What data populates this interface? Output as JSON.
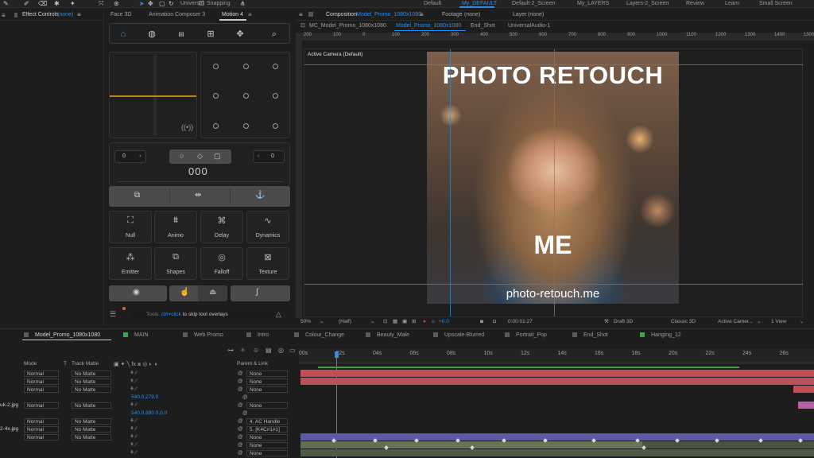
{
  "toolbar": {
    "universal_label": "Universal",
    "snapping_label": "Snapping",
    "workspaces": [
      "Default",
      "My_DEFAULT",
      "Default-2_Screen",
      "My_LAYERS",
      "Layers-2_Screen",
      "Review",
      "Learn",
      "Small Screen"
    ],
    "active_workspace": "My_DEFAULT"
  },
  "effect_controls": {
    "title": "Effect Controls",
    "value": "(none)"
  },
  "motion_panel": {
    "tabs": [
      "Face 3D",
      "Animation Composer 3",
      "Motion 4"
    ],
    "active_tab": "Motion 4",
    "counter_left": "0",
    "counter_right": "0",
    "counter_center": "000",
    "grid_buttons": [
      {
        "label": "Null",
        "icon": "null-icon"
      },
      {
        "label": "Animo",
        "icon": "animo-icon"
      },
      {
        "label": "Delay",
        "icon": "delay-icon"
      },
      {
        "label": "Dynamics",
        "icon": "dynamics-icon"
      },
      {
        "label": "Emitter",
        "icon": "emitter-icon"
      },
      {
        "label": "Shapes",
        "icon": "shapes-icon"
      },
      {
        "label": "Falloff",
        "icon": "falloff-icon"
      },
      {
        "label": "Texture",
        "icon": "texture-icon"
      }
    ],
    "tip_prefix": "Tools:",
    "tip_key": "ctrl+click",
    "tip_suffix": "to skip tool overlays"
  },
  "composition": {
    "header_label": "Composition",
    "header_name": "Model_Promo_1080x1080",
    "footage_label": "Footage",
    "footage_value": "(none)",
    "layer_label": "Layer",
    "layer_value": "(none)",
    "tabs": [
      "MC_Model_Promo_1080x1080",
      "Model_Promo_1080x1080",
      "End_Shot",
      "UniversalAudio-1"
    ],
    "active_tab": "Model_Promo_1080x1080",
    "camera_label": "Active Camera (Default)",
    "ruler_ticks": [
      "200",
      "100",
      "0",
      "100",
      "200",
      "300",
      "400",
      "500",
      "600",
      "700",
      "800",
      "900",
      "1000",
      "1100",
      "1200",
      "1300",
      "1400",
      "1500"
    ],
    "photo_title": "PHOTO RETOUCH",
    "photo_sub": "ME",
    "photo_url": "photo-retouch.me",
    "footer": {
      "zoom": "50%",
      "resolution": "(Half)",
      "exposure": "+0.0",
      "timecode": "0:00:01:27",
      "renderer": "Draft 3D",
      "renderer_mode": "Classic 3D",
      "camera": "Active Camer...",
      "view": "1 View"
    }
  },
  "timeline": {
    "tabs": [
      {
        "label": "Model_Promo_1080x1080",
        "color": "#5b5b5b"
      },
      {
        "label": "MAIN",
        "color": "#3fa34d"
      },
      {
        "label": "Web Promo",
        "color": "#5a5a5a"
      },
      {
        "label": "Intro",
        "color": "#5a5a5a"
      },
      {
        "label": "Colour_Change",
        "color": "#5a5a5a"
      },
      {
        "label": "Beauty_Male",
        "color": "#5a5a5a"
      },
      {
        "label": "Upscale-Blurred",
        "color": "#5a5a5a"
      },
      {
        "label": "Portrait_Pop",
        "color": "#5a5a5a"
      },
      {
        "label": "End_Shot",
        "color": "#5a5a5a"
      },
      {
        "label": "Hanging_12",
        "color": "#3fa34d"
      }
    ],
    "col_mode": "Mode",
    "col_t": "T",
    "col_trackmatte": "Track Matte",
    "col_parent": "Parent & Link",
    "ticks": [
      "00s",
      "02s",
      "04s",
      "06s",
      "08s",
      "10s",
      "12s",
      "14s",
      "16s",
      "18s",
      "20s",
      "22s",
      "24s",
      "26s"
    ],
    "rows": [
      {
        "name": "",
        "mode": "Normal",
        "matte": "No Matte",
        "parent": "None"
      },
      {
        "name": "",
        "mode": "Normal",
        "matte": "No Matte",
        "parent": "None"
      },
      {
        "name": "",
        "mode": "Normal",
        "matte": "No Matte",
        "parent": "None"
      },
      {
        "name": "",
        "value": "540.0,279.0"
      },
      {
        "name": "uk-2.jpg",
        "mode": "Normal",
        "matte": "No Matte",
        "parent": "None"
      },
      {
        "name": "",
        "value": "540.0,880.0,0.0"
      },
      {
        "name": "",
        "mode": "Normal",
        "matte": "No Matte",
        "parent": "4. AC Handle"
      },
      {
        "name": "2-4x.jpg",
        "mode": "Normal",
        "matte": "No Matte",
        "parent": "5. [K4C#1#1]"
      },
      {
        "name": "",
        "mode": "Normal",
        "matte": "No Matte",
        "parent": "None"
      },
      {
        "name": "",
        "mode": "",
        "matte": "",
        "parent": "None"
      },
      {
        "name": "",
        "mode": "",
        "matte": "",
        "parent": "None"
      }
    ]
  }
}
